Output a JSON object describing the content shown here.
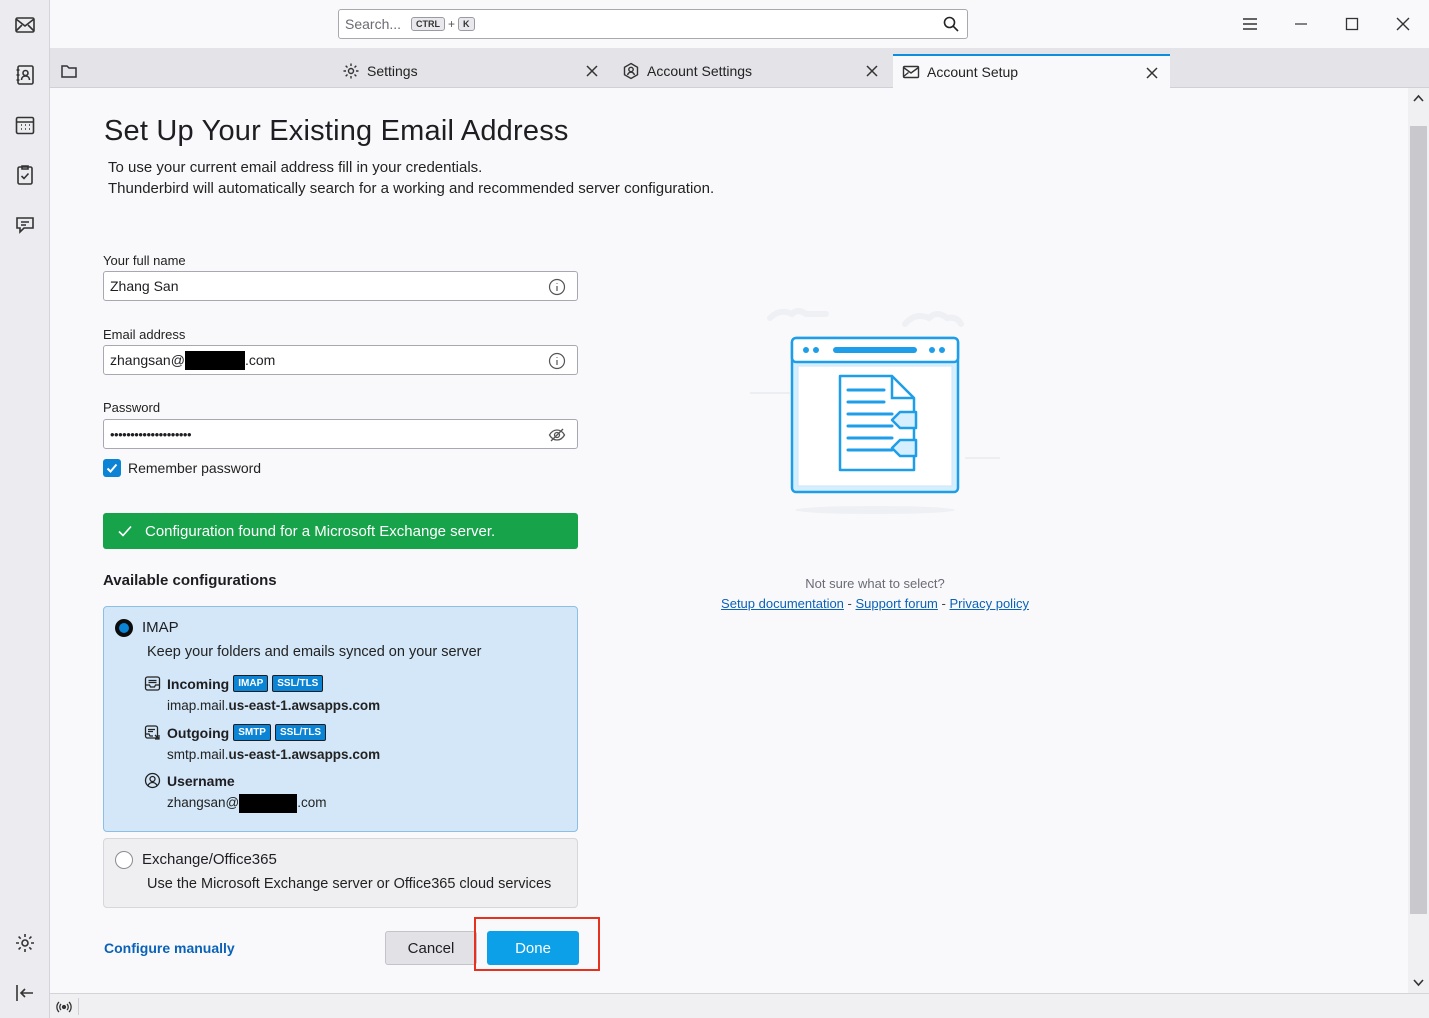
{
  "search": {
    "placeholder": "Search...",
    "kbd1": "CTRL",
    "plus": "+",
    "kbd2": "K"
  },
  "tabs": [
    {
      "label": "Settings"
    },
    {
      "label": "Account Settings"
    },
    {
      "label": "Account Setup"
    }
  ],
  "page": {
    "title": "Set Up Your Existing Email Address",
    "intro_line1": "To use your current email address fill in your credentials.",
    "intro_line2": "Thunderbird will automatically search for a working and recommended server configuration."
  },
  "form": {
    "name_label": "Your full name",
    "name_value": "Zhang San",
    "email_label": "Email address",
    "email_prefix": "zhangsan@",
    "email_suffix": ".com",
    "password_label": "Password",
    "password_value": "••••••••••••••••••••",
    "remember_label": "Remember password",
    "remember_checked": true
  },
  "banner": {
    "text": "Configuration found for a Microsoft Exchange server.",
    "color": "#17a34a"
  },
  "configs": {
    "heading": "Available configurations",
    "imap": {
      "title": "IMAP",
      "desc": "Keep your folders and emails synced on your server",
      "incoming_label": "Incoming",
      "incoming_badges": [
        "IMAP",
        "SSL/TLS"
      ],
      "incoming_host_prefix": "imap.mail.",
      "incoming_host_bold": "us-east-1.awsapps.com",
      "outgoing_label": "Outgoing",
      "outgoing_badges": [
        "SMTP",
        "SSL/TLS"
      ],
      "outgoing_host_prefix": "smtp.mail.",
      "outgoing_host_bold": "us-east-1.awsapps.com",
      "username_label": "Username",
      "username_prefix": "zhangsan@",
      "username_suffix": ".com"
    },
    "exchange": {
      "title": "Exchange/Office365",
      "desc": "Use the Microsoft Exchange server or Office365 cloud services"
    }
  },
  "actions": {
    "configure_manually": "Configure manually",
    "cancel": "Cancel",
    "done": "Done"
  },
  "help": {
    "question": "Not sure what to select?",
    "setup_doc": "Setup documentation",
    "sep": "-",
    "support_forum": "Support forum",
    "privacy_policy": "Privacy policy"
  },
  "colors": {
    "accent": "#0b84d5",
    "done_button": "#0ba0e8",
    "highlight": "#e5311e"
  }
}
